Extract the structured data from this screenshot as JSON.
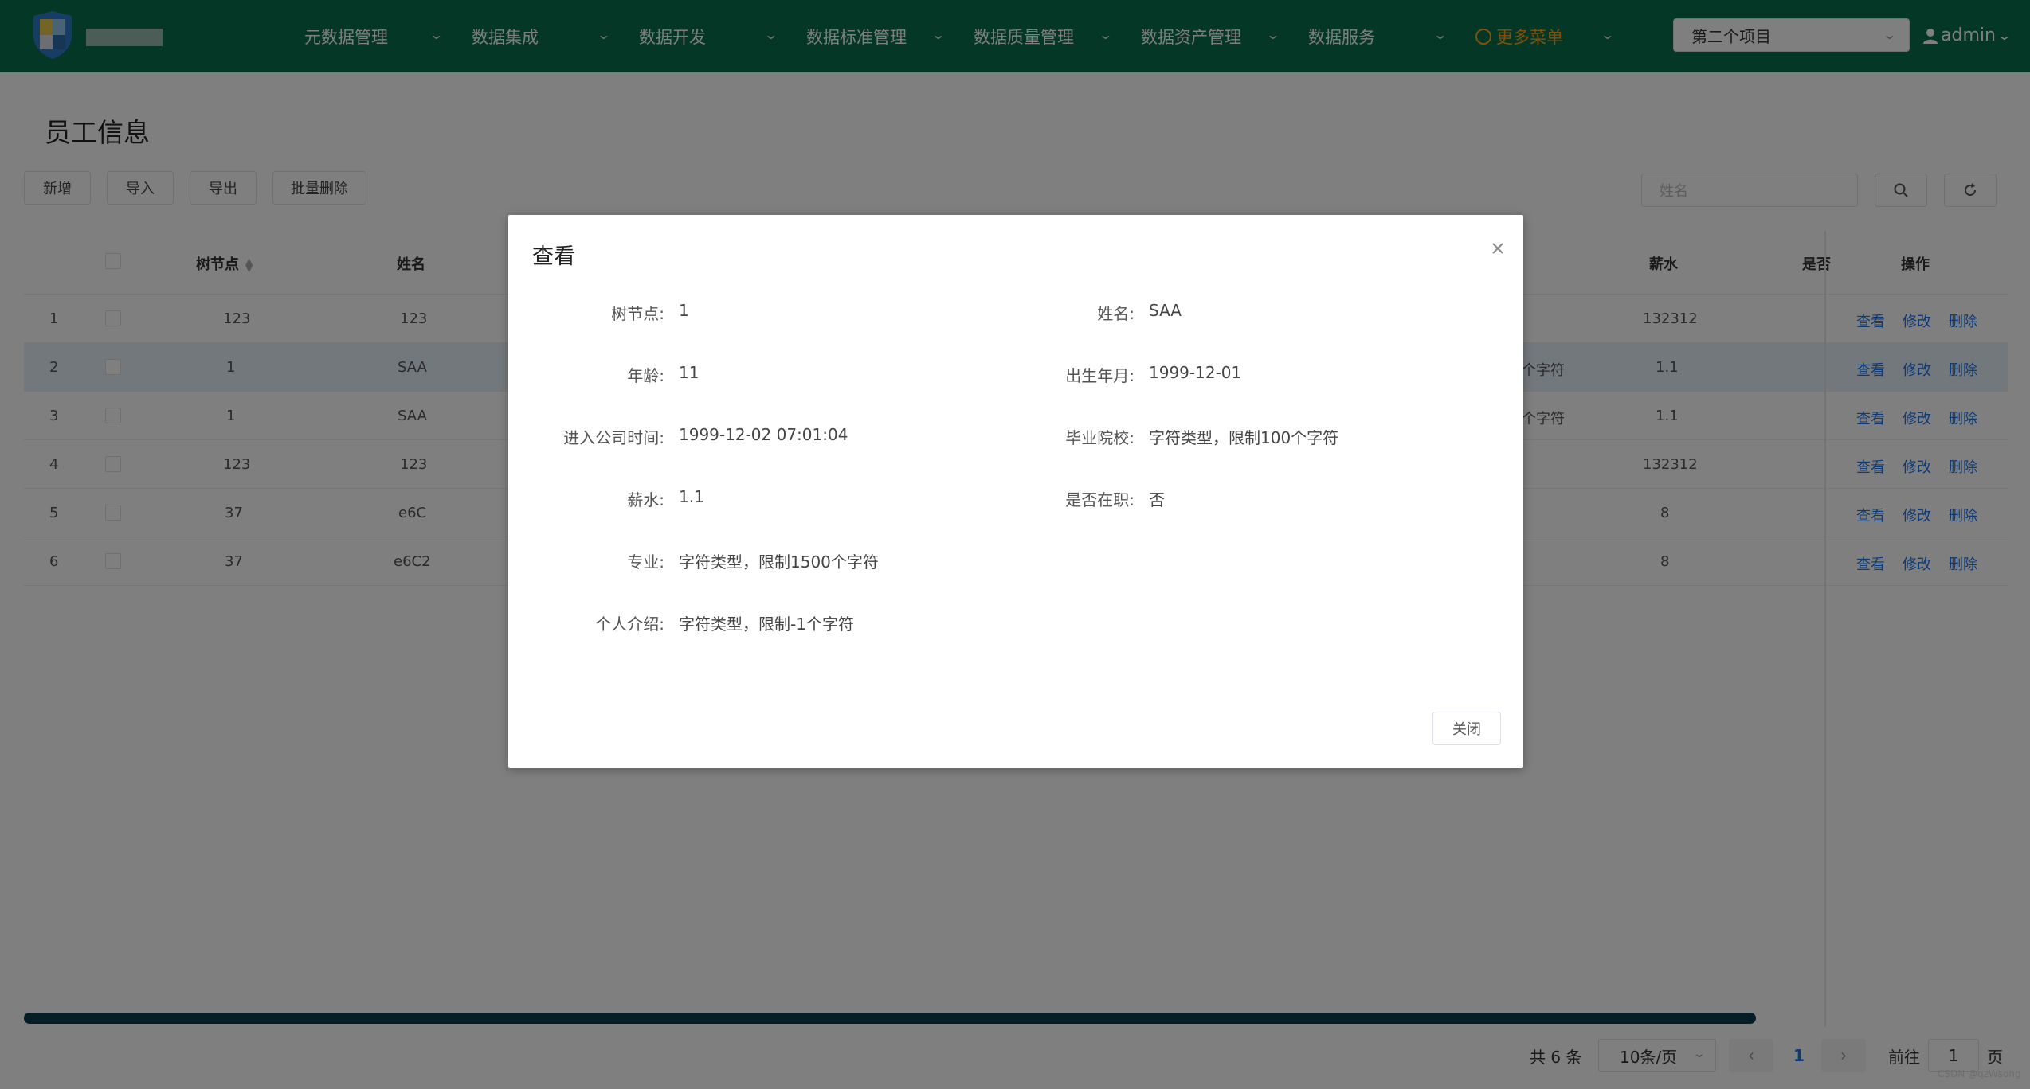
{
  "app": {
    "logo_text": "",
    "nav": [
      {
        "label": "元数据管理"
      },
      {
        "label": "数据集成"
      },
      {
        "label": "数据开发"
      },
      {
        "label": "数据标准管理"
      },
      {
        "label": "数据质量管理"
      },
      {
        "label": "数据资产管理"
      },
      {
        "label": "数据服务"
      },
      {
        "label": "更多菜单"
      }
    ],
    "project_select": "第二个项目",
    "user": "admin"
  },
  "page": {
    "title": "员工信息",
    "toolbar": {
      "add": "新增",
      "import": "导入",
      "export": "导出",
      "batch_delete": "批量删除"
    },
    "search": {
      "placeholder": "姓名"
    }
  },
  "table": {
    "headers": {
      "tree_node": "树节点",
      "name": "姓名",
      "salary": "薪水",
      "is_active": "是否",
      "ops": "操作"
    },
    "rows": [
      {
        "idx": "1",
        "tree": "123",
        "name": "123",
        "mid": "",
        "salary": "132312"
      },
      {
        "idx": "2",
        "tree": "1",
        "name": "SAA",
        "mid": "个字符",
        "salary": "1.1"
      },
      {
        "idx": "3",
        "tree": "1",
        "name": "SAA",
        "mid": "个字符",
        "salary": "1.1"
      },
      {
        "idx": "4",
        "tree": "123",
        "name": "123",
        "mid": "",
        "salary": "132312"
      },
      {
        "idx": "5",
        "tree": "37",
        "name": "e6C",
        "mid": "",
        "salary": "8"
      },
      {
        "idx": "6",
        "tree": "37",
        "name": "e6C2",
        "mid": "",
        "salary": "8"
      }
    ],
    "ops": {
      "view": "查看",
      "edit": "修改",
      "delete": "删除"
    }
  },
  "pagination": {
    "total": "共 6 条",
    "page_size": "10条/页",
    "current": "1",
    "goto_label": "前往",
    "goto_value": "1",
    "page_suffix": "页"
  },
  "watermark": "CSDN @qzWsong",
  "dialog": {
    "title": "查看",
    "fields": {
      "tree_node": {
        "label": "树节点:",
        "value": "1"
      },
      "name": {
        "label": "姓名:",
        "value": "SAA"
      },
      "age": {
        "label": "年龄:",
        "value": "11"
      },
      "birth": {
        "label": "出生年月:",
        "value": "1999-12-01"
      },
      "join_time": {
        "label": "进入公司时间:",
        "value": "1999-12-02 07:01:04"
      },
      "school": {
        "label": "毕业院校:",
        "value": "字符类型，限制100个字符"
      },
      "salary": {
        "label": "薪水:",
        "value": "1.1"
      },
      "active": {
        "label": "是否在职:",
        "value": "否"
      },
      "major": {
        "label": "专业:",
        "value": "字符类型，限制1500个字符"
      },
      "intro": {
        "label": "个人介绍:",
        "value": "字符类型，限制-1个字符"
      }
    },
    "close_button": "关闭"
  },
  "colors": {
    "nav_bg": "#0b6e4f",
    "link": "#1a73e8",
    "more_menu": "#f5a623"
  }
}
